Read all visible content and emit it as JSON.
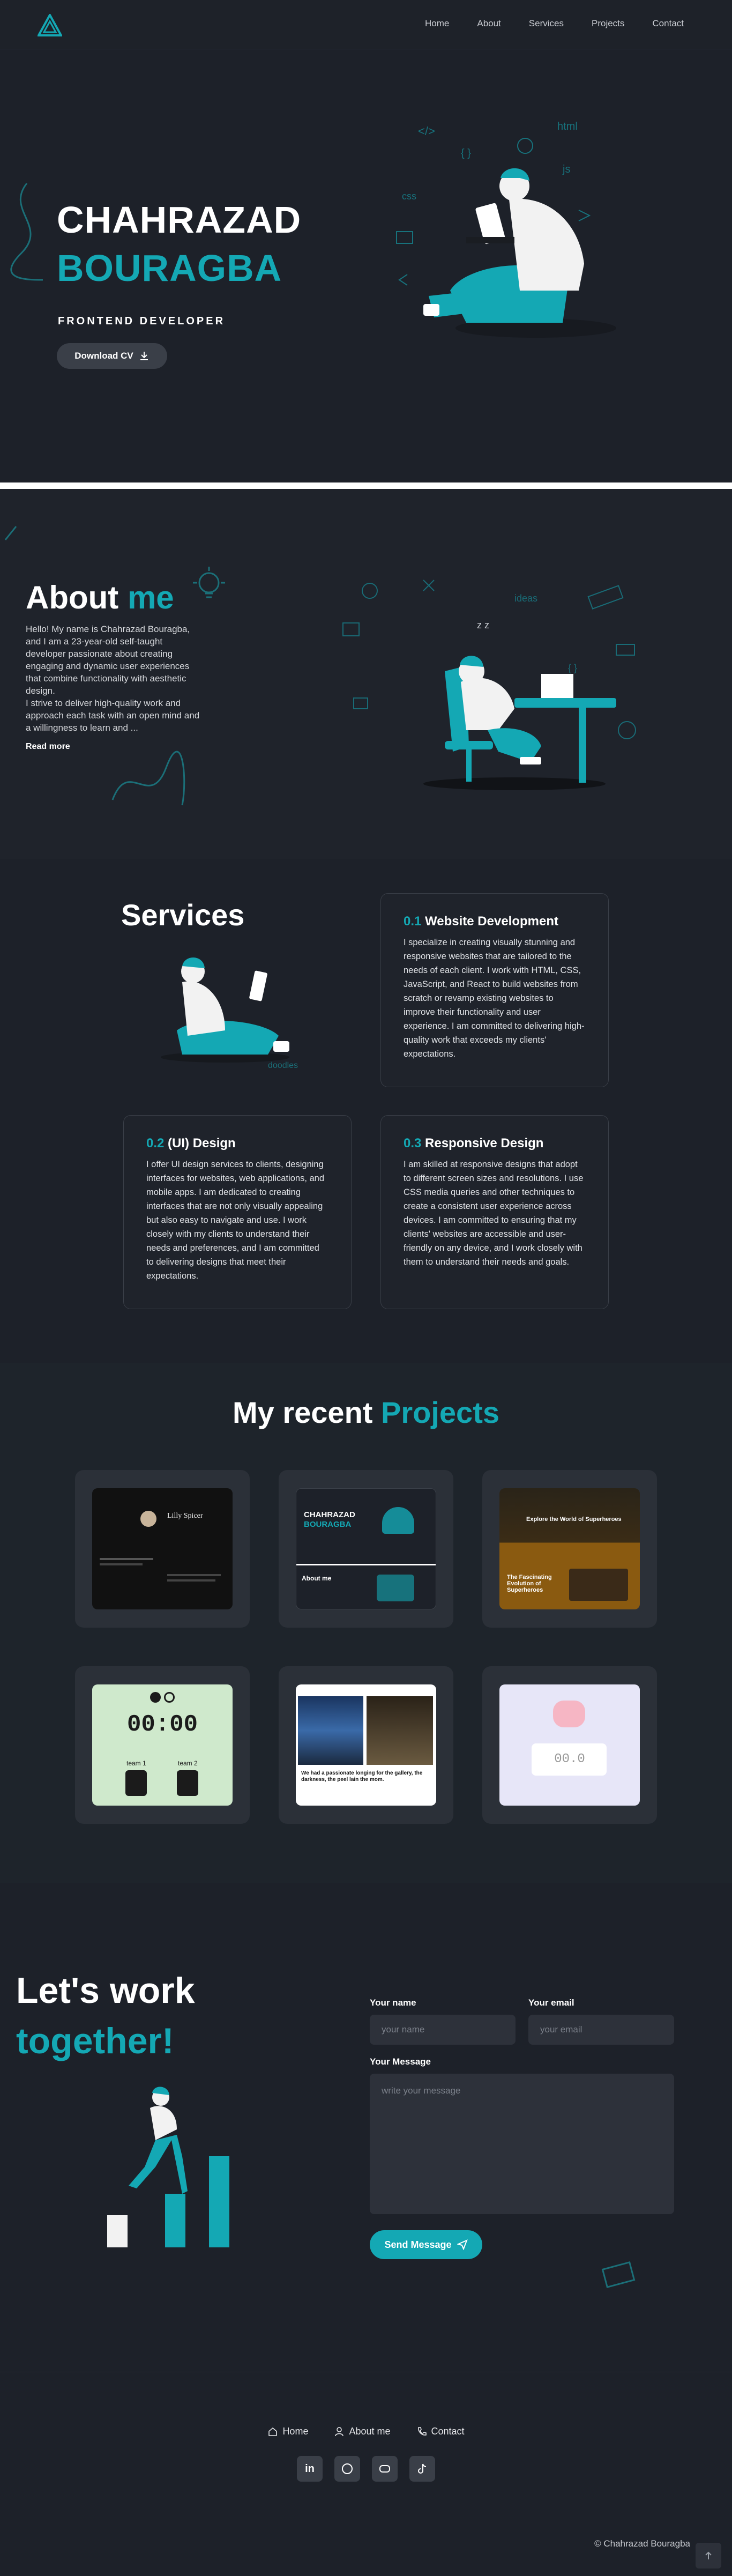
{
  "nav": {
    "links": [
      "Home",
      "About",
      "Services",
      "Projects",
      "Contact"
    ]
  },
  "hero": {
    "first_name": "CHAHRAZAD",
    "last_name": "BOURAGBA",
    "role": "FRONTEND DEVELOPER",
    "cv_label": "Download CV"
  },
  "about": {
    "title_a": "About",
    "title_b": "me",
    "text": "Hello! My name is Chahrazad Bouragba, and I am a 23-year-old self-taught developer passionate about creating engaging and dynamic user experiences that combine functionality with aesthetic design.",
    "text2": "I strive to deliver high-quality work and approach each task with an open mind and a willingness to learn and ...",
    "read_more": "Read more"
  },
  "services": {
    "title": "Services",
    "items": [
      {
        "num": "0.1",
        "title": "Website Development",
        "text": "I specialize in creating visually stunning and responsive websites that are tailored to the needs of each client. I work with HTML, CSS, JavaScript, and React to build websites from scratch or revamp existing websites to improve their functionality and user experience. I am committed to delivering high-quality work that exceeds my clients' expectations."
      },
      {
        "num": "0.2",
        "title": "(UI) Design",
        "text": "I offer UI design services to clients, designing interfaces for websites, web applications, and mobile apps. I am dedicated to creating interfaces that are not only visually appealing but also easy to navigate and use. I work closely with my clients to understand their needs and preferences, and I am committed to delivering designs that meet their expectations."
      },
      {
        "num": "0.3",
        "title": "Responsive Design",
        "text": "I am skilled at responsive designs that adopt to different screen sizes and resolutions. I use CSS media queries and other techniques to create a consistent user experience across devices. I am committed to ensuring that my clients' websites are accessible and user-friendly on any device, and I work closely with them to understand their needs and goals."
      }
    ]
  },
  "projects": {
    "title_a": "My recent",
    "title_b": "Projects",
    "thumb1": {
      "title": "Lilly Spicer"
    },
    "thumb2": {
      "name1": "CHAHRAZAD",
      "name2": "BOURAGBA",
      "about": "About me"
    },
    "thumb3": {
      "headline": "Explore the World of Superheroes",
      "sub": "The Fascinating Evolution of Superheroes"
    },
    "thumb4": {
      "clock": "00:00",
      "team1": "team 1",
      "team2": "team 2"
    },
    "thumb5": {
      "caption": "We had a passionate longing for the gallery, the darkness, the peel lain the mom."
    },
    "thumb6": {
      "score": "00.0"
    }
  },
  "contact": {
    "title_a": "Let's work",
    "title_b": "together!",
    "name_label": "Your name",
    "name_placeholder": "your name",
    "email_label": "Your email",
    "email_placeholder": "your email",
    "message_label": "Your Message",
    "message_placeholder": "write your message",
    "send_label": "Send Message"
  },
  "footer": {
    "links": [
      "Home",
      "About me",
      "Contact"
    ],
    "copyright": "© Chahrazad Bouragba",
    "socials": [
      "linkedin-icon",
      "github-icon",
      "discord-icon",
      "tiktok-icon"
    ]
  },
  "colors": {
    "accent": "#14a8b4",
    "bg": "#1d2129",
    "card": "#2b3038"
  }
}
